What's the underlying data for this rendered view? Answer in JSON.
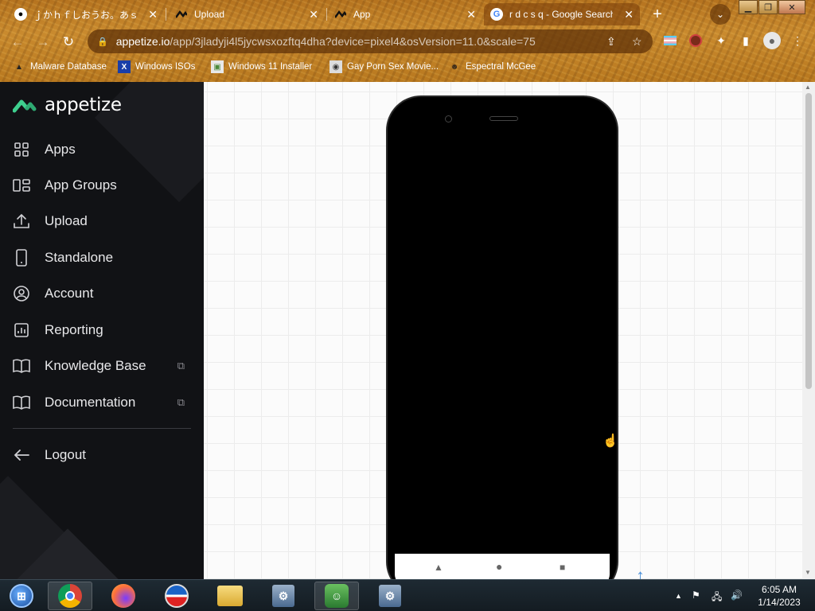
{
  "browser": {
    "tabs": [
      {
        "title": "ｊかｈｆしおうお。あｓｄ",
        "favicon": "panda-icon"
      },
      {
        "title": "Upload",
        "favicon": "appetize-icon"
      },
      {
        "title": "App",
        "favicon": "appetize-icon"
      },
      {
        "title": "r d c s q - Google Search",
        "favicon": "google-icon",
        "active": true
      }
    ],
    "url_host": "appetize.io",
    "url_path": "/app/3jladyji4l5jycwsxozftq4dha?device=pixel4&osVersion=11.0&scale=75",
    "bookmarks": [
      {
        "label": "Malware Database"
      },
      {
        "label": "Windows ISOs"
      },
      {
        "label": "Windows 11 Installer"
      },
      {
        "label": "Gay Porn Sex Movie..."
      },
      {
        "label": "Espectral McGee"
      }
    ],
    "win_controls": {
      "minimize": "▁",
      "restore": "❐",
      "close": "✕"
    }
  },
  "sidebar": {
    "brand": "appetize",
    "items": [
      {
        "label": "Apps",
        "icon": "apps-grid-icon"
      },
      {
        "label": "App Groups",
        "icon": "app-groups-icon"
      },
      {
        "label": "Upload",
        "icon": "upload-icon"
      },
      {
        "label": "Standalone",
        "icon": "phone-icon"
      },
      {
        "label": "Account",
        "icon": "account-icon"
      },
      {
        "label": "Reporting",
        "icon": "reporting-icon"
      },
      {
        "label": "Knowledge Base",
        "icon": "book-icon",
        "external": true
      },
      {
        "label": "Documentation",
        "icon": "book-icon",
        "external": true
      }
    ],
    "logout": "Logout"
  },
  "colors": {
    "brand_accent": "#3ecf8e",
    "sidebar_bg": "#111215",
    "chrome_theme": "#c08028"
  },
  "taskbar": {
    "time": "6:05 AM",
    "date": "1/14/2023"
  }
}
